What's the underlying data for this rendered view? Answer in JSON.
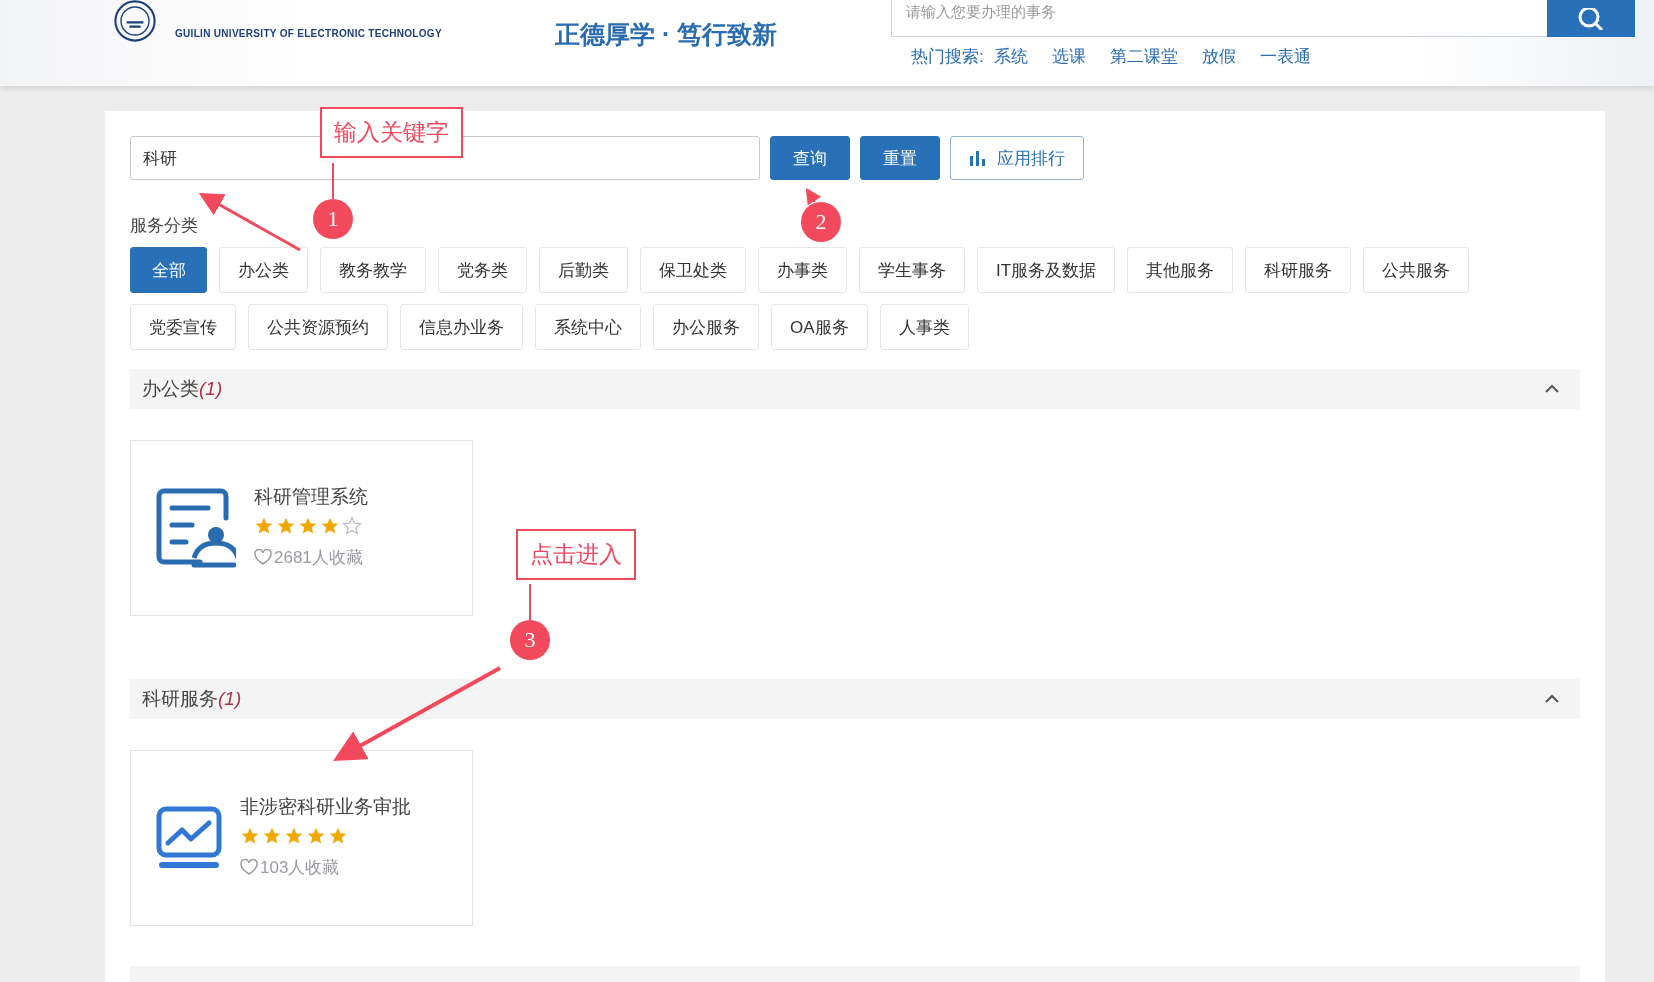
{
  "header": {
    "university_name": "GUILIN UNIVERSITY OF ELECTRONIC TECHNOLOGY",
    "slogan": "正德厚学 · 笃行致新",
    "search": {
      "placeholder": "请输入您要办理的事务"
    },
    "hot_search": {
      "label": "热门搜索:",
      "items": [
        "系统",
        "选课",
        "第二课堂",
        "放假",
        "一表通"
      ]
    }
  },
  "search": {
    "value": "科研"
  },
  "buttons": [
    {
      "label": "查询",
      "kind": "primary"
    },
    {
      "label": "重置",
      "kind": "primary"
    },
    {
      "label": "应用排行",
      "kind": "ranking"
    }
  ],
  "category_label": "服务分类",
  "categories": [
    {
      "label": "全部",
      "selected": true
    },
    {
      "label": "办公类",
      "selected": false
    },
    {
      "label": "教务教学",
      "selected": false
    },
    {
      "label": "党务类",
      "selected": false
    },
    {
      "label": "后勤类",
      "selected": false
    },
    {
      "label": "保卫处类",
      "selected": false
    },
    {
      "label": "办事类",
      "selected": false
    },
    {
      "label": "学生事务",
      "selected": false
    },
    {
      "label": "IT服务及数据",
      "selected": false
    },
    {
      "label": "其他服务",
      "selected": false
    },
    {
      "label": "科研服务",
      "selected": false
    },
    {
      "label": "公共服务",
      "selected": false
    },
    {
      "label": "党委宣传",
      "selected": false
    },
    {
      "label": "公共资源预约",
      "selected": false
    },
    {
      "label": "信息办业务",
      "selected": false
    },
    {
      "label": "系统中心",
      "selected": false
    },
    {
      "label": "办公服务",
      "selected": false
    },
    {
      "label": "OA服务",
      "selected": false
    },
    {
      "label": "人事类",
      "selected": false
    }
  ],
  "sections": [
    {
      "title": "办公类",
      "count": "(1)",
      "expanded": true,
      "apps": [
        {
          "name": "科研管理系统",
          "kind": "document-reader",
          "stars": 4,
          "favorites": "2681人收藏"
        }
      ]
    },
    {
      "title": "科研服务",
      "count": "(1)",
      "expanded": true,
      "apps": [
        {
          "name": "非涉密科研业务审批",
          "kind": "chart-monitor",
          "stars": 5,
          "favorites": "103人收藏"
        }
      ]
    }
  ],
  "annotations": {
    "labels": [
      "输入关键字",
      "点击进入"
    ],
    "steps": [
      "1",
      "2",
      "3"
    ]
  }
}
